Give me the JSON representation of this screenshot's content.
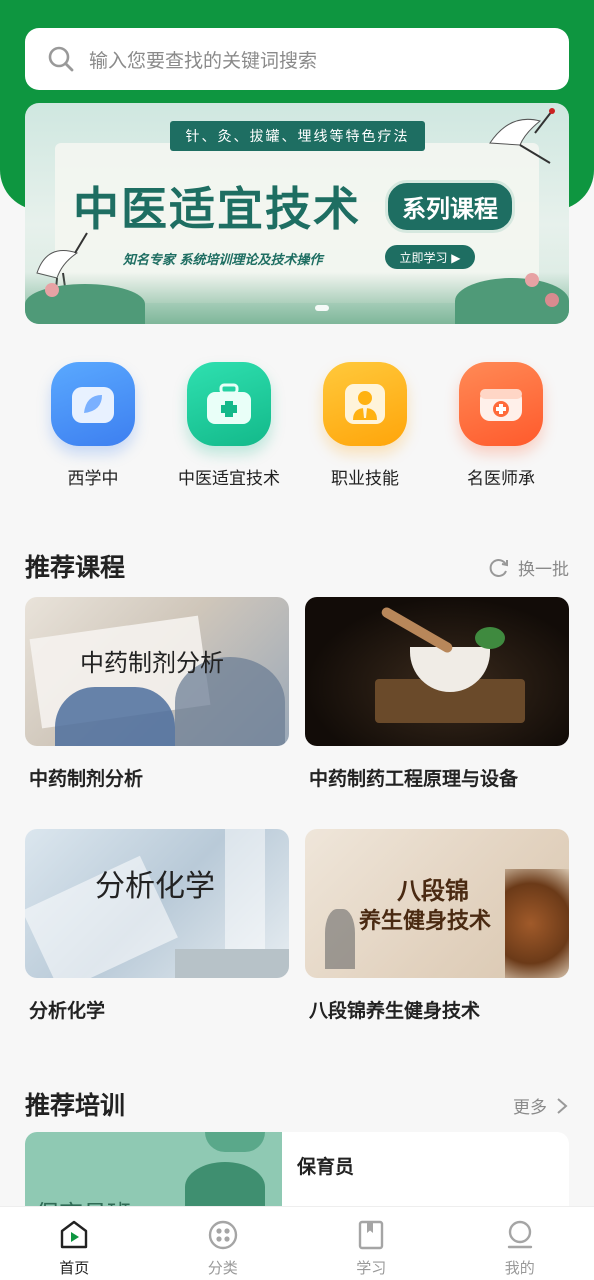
{
  "search": {
    "placeholder": "输入您要查找的关键词搜索"
  },
  "banner": {
    "ribbon": "针、灸、拔罐、埋线等特色疗法",
    "title": "中医适宜技术",
    "series": "系列课程",
    "subtitle": "知名专家 系统培训理论及技术操作",
    "cta": "立即学习 ▶"
  },
  "categories": [
    {
      "label": "西学中",
      "icon": "leaf-icon",
      "color": "#3d8ff2"
    },
    {
      "label": "中医适宜技术",
      "icon": "medical-kit-icon",
      "color": "#17c196"
    },
    {
      "label": "职业技能",
      "icon": "person-tie-icon",
      "color": "#ffb212"
    },
    {
      "label": "名医师承",
      "icon": "medicine-box-icon",
      "color": "#ff6a3a"
    }
  ],
  "recommend_courses": {
    "title": "推荐课程",
    "refresh_label": "换一批",
    "items": [
      {
        "name": "中药制剂分析",
        "overlay": "中药制剂分析"
      },
      {
        "name": "中药制药工程原理与设备",
        "overlay": ""
      },
      {
        "name": "分析化学",
        "overlay": "分析化学"
      },
      {
        "name": "八段锦养生健身技术",
        "overlay_line1": "八段锦",
        "overlay_line2": "养生健身技术"
      }
    ]
  },
  "recommend_training": {
    "title": "推荐培训",
    "more_label": "更多",
    "items": [
      {
        "name": "保育员",
        "image_text": "保育员班"
      }
    ]
  },
  "tabbar": [
    {
      "label": "首页",
      "icon": "home-play-icon",
      "active": true
    },
    {
      "label": "分类",
      "icon": "category-dots-icon",
      "active": false
    },
    {
      "label": "学习",
      "icon": "book-icon",
      "active": false
    },
    {
      "label": "我的",
      "icon": "profile-icon",
      "active": false
    }
  ],
  "colors": {
    "brand_green": "#0e9640",
    "banner_teal": "#1e6e62"
  }
}
